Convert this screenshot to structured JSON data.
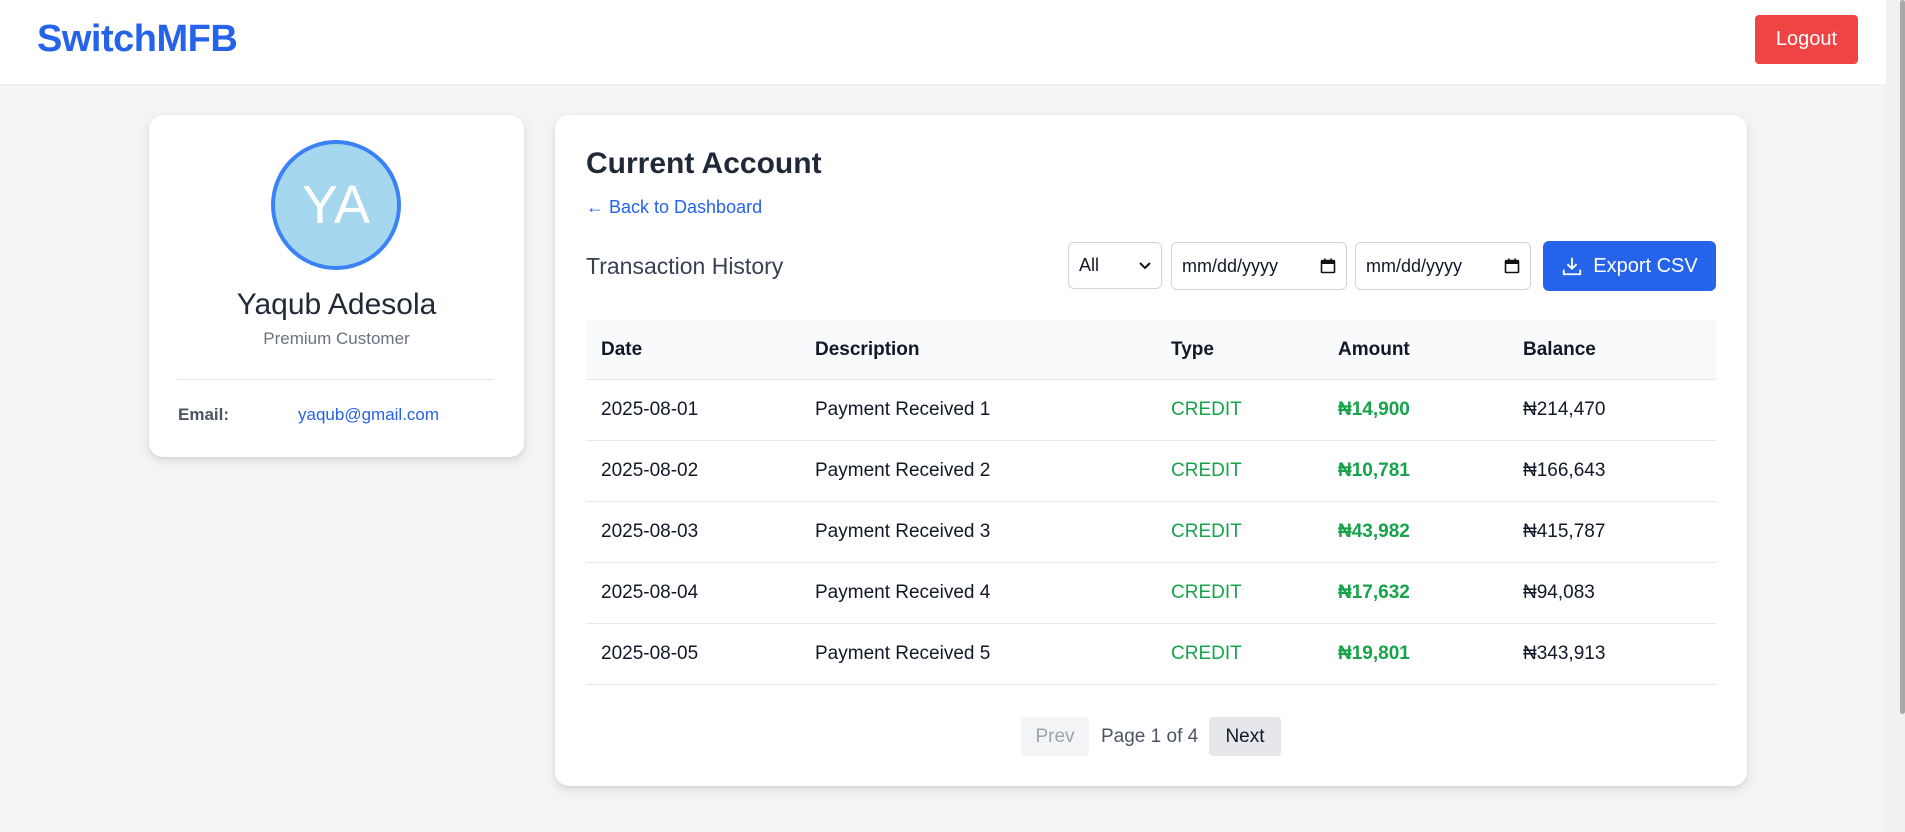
{
  "header": {
    "brand": "SwitchMFB",
    "logout_label": "Logout"
  },
  "profile": {
    "initials": "YA",
    "name": "Yaqub Adesola",
    "tier": "Premium Customer",
    "email_label": "Email:",
    "email": "yaqub@gmail.com"
  },
  "account": {
    "title": "Current Account",
    "back_link": "← Back to Dashboard",
    "history_title": "Transaction History",
    "filter_type": "All",
    "date_from_placeholder": "mm/dd/yyyy",
    "date_to_placeholder": "mm/dd/yyyy",
    "export_label": "Export CSV"
  },
  "table": {
    "columns": [
      "Date",
      "Description",
      "Type",
      "Amount",
      "Balance"
    ],
    "rows": [
      {
        "date": "2025-08-01",
        "description": "Payment Received 1",
        "type": "CREDIT",
        "amount": "₦14,900",
        "balance": "₦214,470"
      },
      {
        "date": "2025-08-02",
        "description": "Payment Received 2",
        "type": "CREDIT",
        "amount": "₦10,781",
        "balance": "₦166,643"
      },
      {
        "date": "2025-08-03",
        "description": "Payment Received 3",
        "type": "CREDIT",
        "amount": "₦43,982",
        "balance": "₦415,787"
      },
      {
        "date": "2025-08-04",
        "description": "Payment Received 4",
        "type": "CREDIT",
        "amount": "₦17,632",
        "balance": "₦94,083"
      },
      {
        "date": "2025-08-05",
        "description": "Payment Received 5",
        "type": "CREDIT",
        "amount": "₦19,801",
        "balance": "₦343,913"
      }
    ]
  },
  "pagination": {
    "prev_label": "Prev",
    "page_info": "Page 1 of 4",
    "next_label": "Next"
  },
  "colors": {
    "brand": "#2563eb",
    "danger": "#ef4444",
    "credit": "#16a34a"
  },
  "icons": {
    "date_picker": "calendar-icon",
    "export": "download-icon",
    "select": "chevron-down-icon"
  }
}
